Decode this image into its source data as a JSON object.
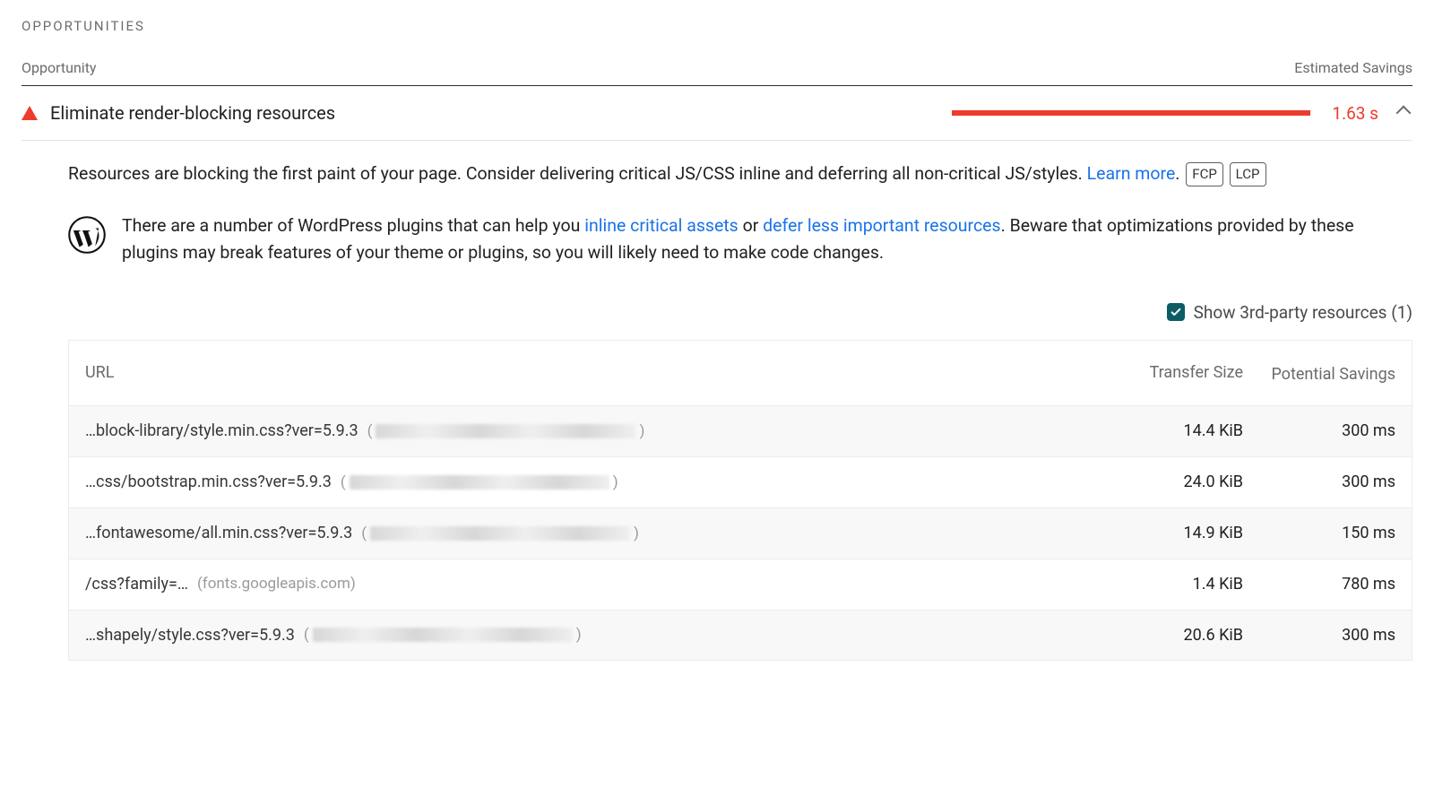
{
  "section_title": "OPPORTUNITIES",
  "columns": {
    "left": "Opportunity",
    "right": "Estimated Savings"
  },
  "audit": {
    "title": "Eliminate render-blocking resources",
    "savings": "1.63 s",
    "description_1": "Resources are blocking the first paint of your page. Consider delivering critical JS/CSS inline and deferring all non-critical JS/styles. ",
    "learn_more": "Learn more",
    "period": ".",
    "badges": [
      "FCP",
      "LCP"
    ],
    "wp_before": "There are a number of WordPress plugins that can help you ",
    "wp_link1": "inline critical assets",
    "wp_or": " or ",
    "wp_link2": "defer less important resources",
    "wp_after": ". Beware that optimizations provided by these plugins may break features of your theme or plugins, so you will likely need to make code changes.",
    "filter_label": "Show 3rd-party resources (1)"
  },
  "table": {
    "headers": {
      "url": "URL",
      "size": "Transfer Size",
      "savings": "Potential Savings"
    },
    "rows": [
      {
        "path": "…block-library/style.min.css?ver=5.9.3",
        "host_redacted": true,
        "host": "",
        "size": "14.4 KiB",
        "savings": "300 ms"
      },
      {
        "path": "…css/bootstrap.min.css?ver=5.9.3",
        "host_redacted": true,
        "host": "",
        "size": "24.0 KiB",
        "savings": "300 ms"
      },
      {
        "path": "…fontawesome/all.min.css?ver=5.9.3",
        "host_redacted": true,
        "host": "",
        "size": "14.9 KiB",
        "savings": "150 ms"
      },
      {
        "path": "/css?family=…",
        "host_redacted": false,
        "host": "(fonts.googleapis.com)",
        "size": "1.4 KiB",
        "savings": "780 ms"
      },
      {
        "path": "…shapely/style.css?ver=5.9.3",
        "host_redacted": true,
        "host": "",
        "size": "20.6 KiB",
        "savings": "300 ms"
      }
    ]
  }
}
